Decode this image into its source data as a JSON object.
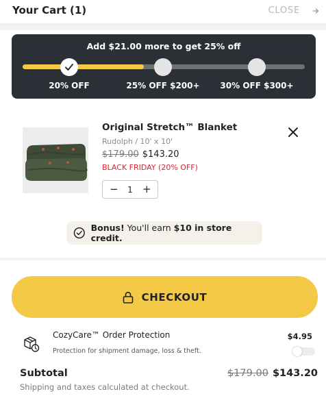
{
  "header": {
    "title": "Your Cart (1)",
    "close_label": "CLOSE"
  },
  "progress": {
    "message": "Add $21.00 more to get 25% off",
    "fill_fraction": 0.43,
    "milestones": [
      {
        "label": "20% OFF",
        "reached": true
      },
      {
        "label": "25% OFF $200+",
        "reached": false
      },
      {
        "label": "30% OFF $300+",
        "reached": false
      }
    ]
  },
  "item": {
    "name": "Original Stretch™ Blanket",
    "variant": "Rudolph / 10' x 10'",
    "original_price": "$179.00",
    "sale_price": "$143.20",
    "promo": "BLACK FRIDAY (20% OFF)",
    "quantity": "1",
    "qty_minus": "−",
    "qty_plus": "+"
  },
  "bonus": {
    "lead": "Bonus!",
    "text_before": " You'll earn ",
    "amount": "$10 in store credit.",
    "text_after": ""
  },
  "checkout": {
    "label": "CHECKOUT"
  },
  "protection": {
    "title": "CozyCare™ Order Protection",
    "description": "Protection for shipment damage, loss & theft.",
    "price": "$4.95",
    "enabled": false
  },
  "summary": {
    "subtotal_label": "Subtotal",
    "original_total": "$179.00",
    "total": "$143.20",
    "note": "Shipping and taxes calculated at checkout."
  },
  "colors": {
    "accent": "#f4c945",
    "dark_panel": "#2b2f36",
    "promo_red": "#d9232d"
  }
}
